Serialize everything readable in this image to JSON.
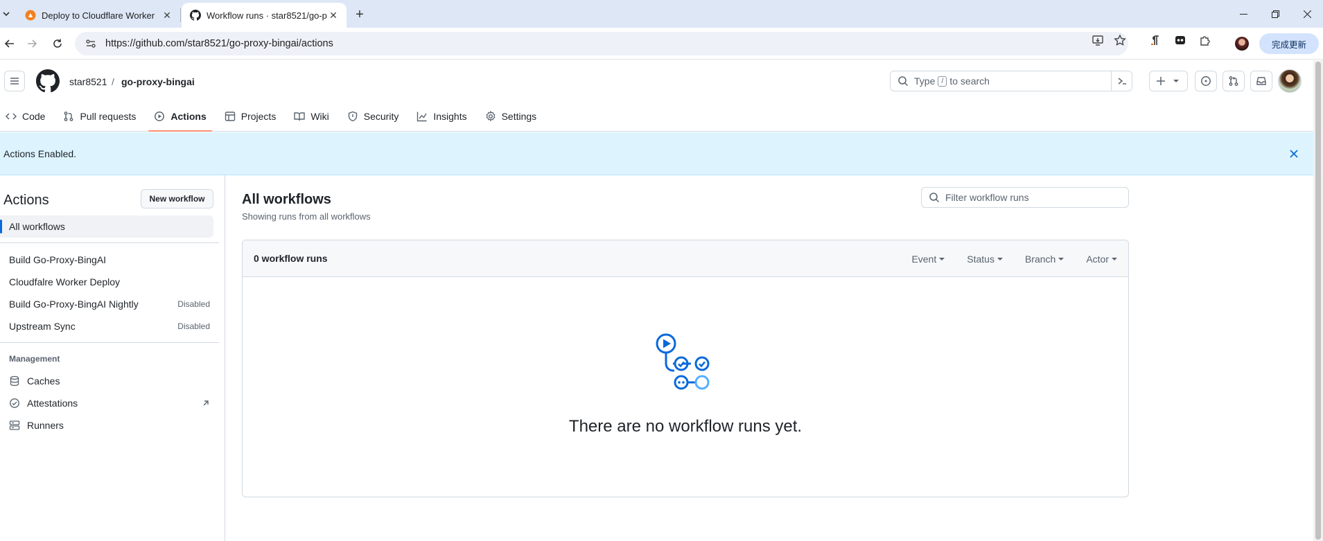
{
  "browser": {
    "tabs": [
      {
        "title": "Deploy to Cloudflare Worker",
        "active": false
      },
      {
        "title": "Workflow runs · star8521/go-proxy-bingai",
        "active": true
      }
    ],
    "url": "https://github.com/star8521/go-proxy-bingai/actions",
    "update_label": "完成更新"
  },
  "header": {
    "owner": "star8521",
    "separator": "/",
    "repo": "go-proxy-bingai",
    "search_prefix": "Type",
    "search_key": "/",
    "search_suffix": "to search"
  },
  "repo_nav": [
    {
      "label": "Code",
      "icon": "code-icon"
    },
    {
      "label": "Pull requests",
      "icon": "pull-request-icon"
    },
    {
      "label": "Actions",
      "icon": "play-icon",
      "active": true
    },
    {
      "label": "Projects",
      "icon": "table-icon"
    },
    {
      "label": "Wiki",
      "icon": "book-icon"
    },
    {
      "label": "Security",
      "icon": "shield-icon"
    },
    {
      "label": "Insights",
      "icon": "graph-icon"
    },
    {
      "label": "Settings",
      "icon": "gear-icon"
    }
  ],
  "flash": {
    "message": "Actions Enabled."
  },
  "sidebar": {
    "title": "Actions",
    "new_workflow": "New workflow",
    "all_workflows": "All workflows",
    "workflows": [
      {
        "name": "Build Go-Proxy-BingAI",
        "badge": ""
      },
      {
        "name": "Cloudfalre Worker Deploy",
        "badge": ""
      },
      {
        "name": "Build Go-Proxy-BingAI Nightly",
        "badge": "Disabled"
      },
      {
        "name": "Upstream Sync",
        "badge": "Disabled"
      }
    ],
    "management_heading": "Management",
    "management": [
      {
        "label": "Caches",
        "icon": "database-icon"
      },
      {
        "label": "Attestations",
        "icon": "verified-icon"
      },
      {
        "label": "Runners",
        "icon": "server-icon"
      }
    ]
  },
  "main": {
    "title": "All workflows",
    "subtitle": "Showing runs from all workflows",
    "filter_placeholder": "Filter workflow runs",
    "runs_count": "0 workflow runs",
    "filters": [
      "Event",
      "Status",
      "Branch",
      "Actor"
    ],
    "empty_message": "There are no workflow runs yet."
  },
  "colors": {
    "accent": "#0969da",
    "flash_bg": "#ddf4ff",
    "nav_underline": "#fd8c73"
  }
}
